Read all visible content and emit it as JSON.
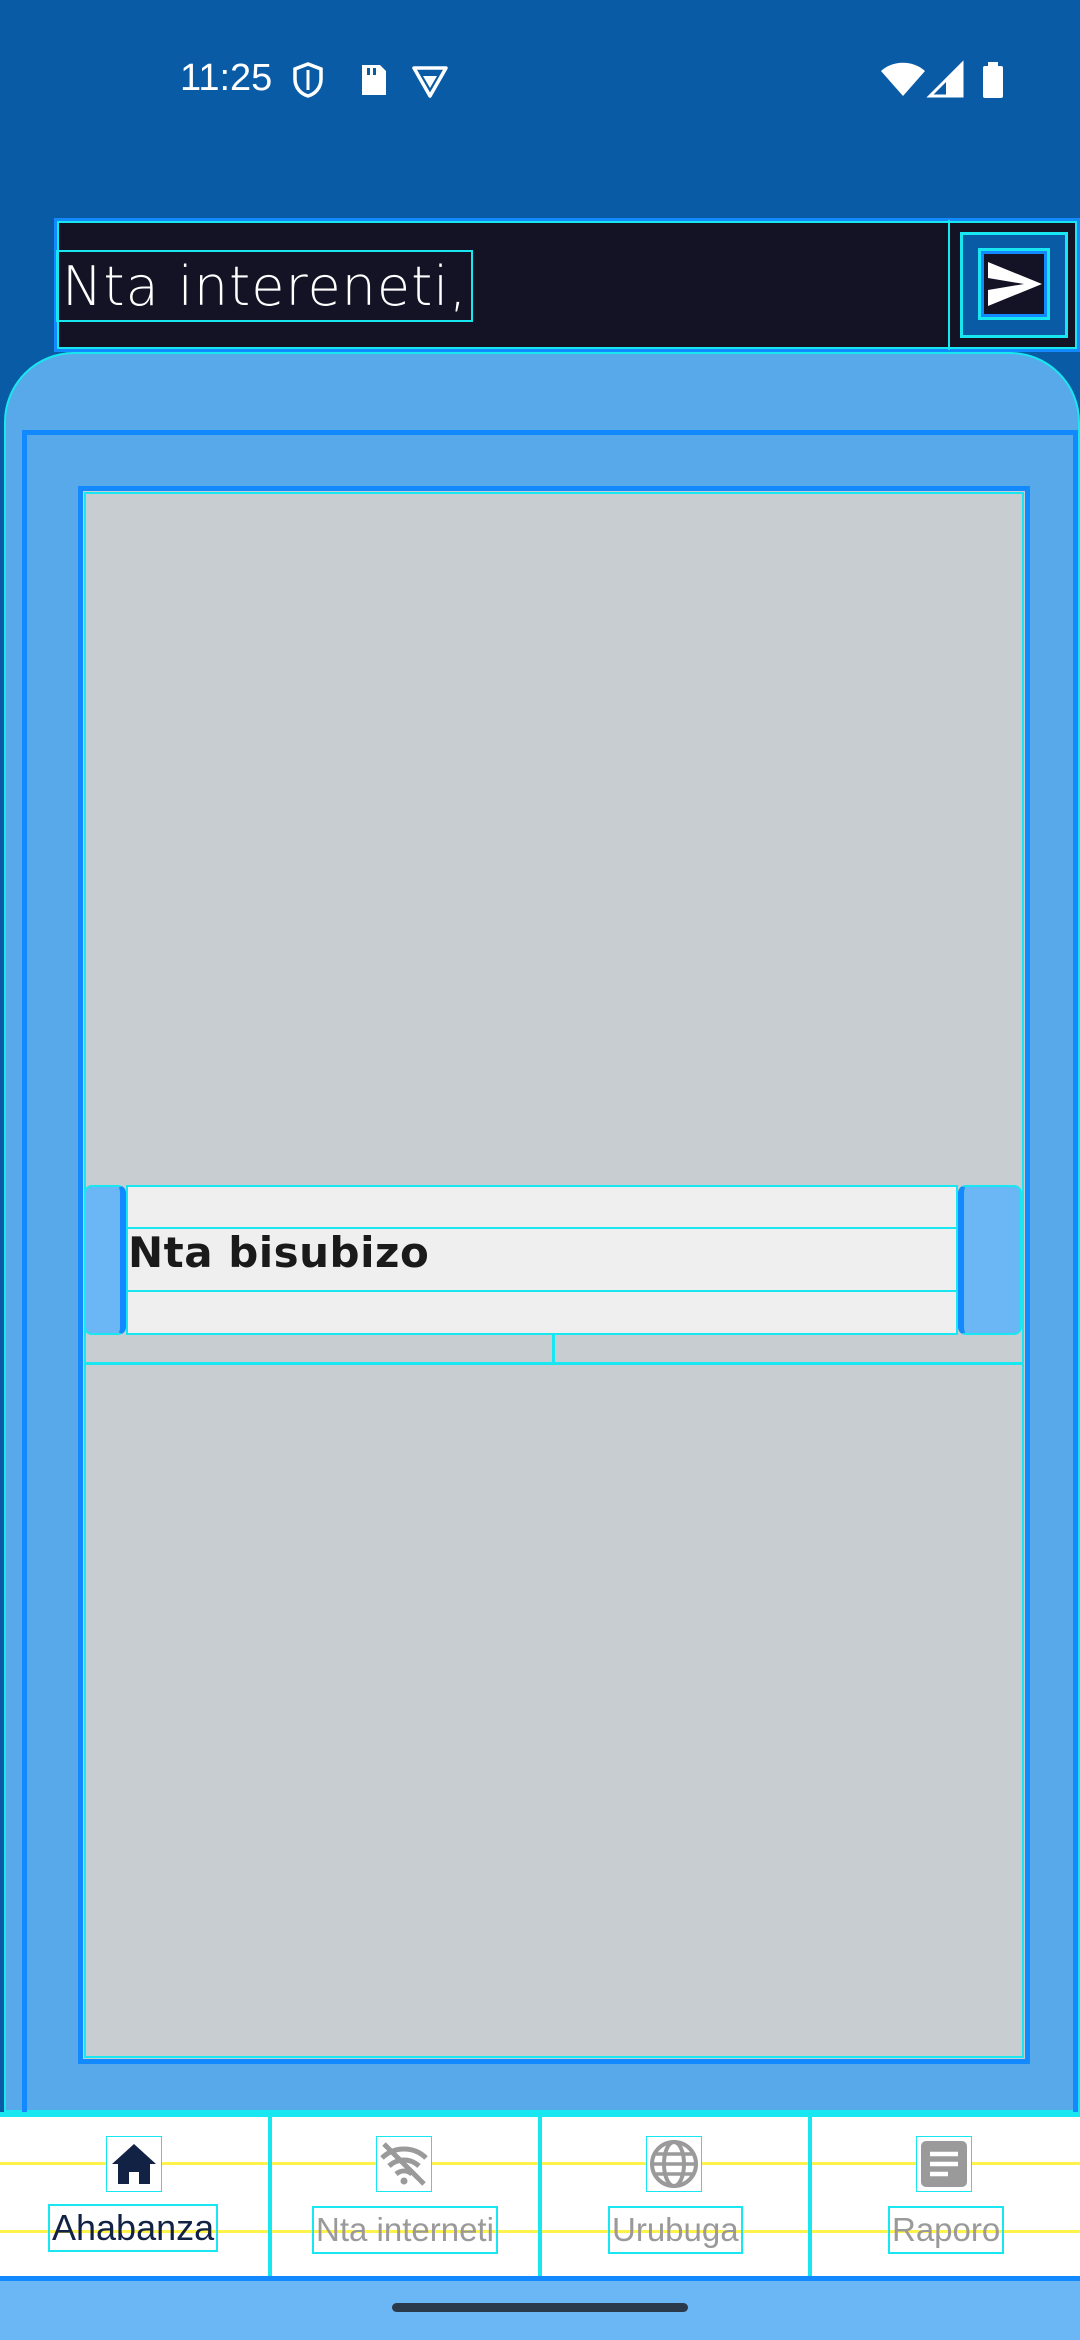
{
  "status_bar": {
    "time": "11:25",
    "icons": [
      "shield-icon",
      "sd-card-icon",
      "vpn-icon",
      "wifi-icon",
      "signal-icon",
      "battery-icon"
    ]
  },
  "header": {
    "title": "Nta intereneti,",
    "send_icon": "send-icon"
  },
  "main": {
    "message_text": "Nta bisubizo"
  },
  "bottom_nav": {
    "items": [
      {
        "label": "Ahabanza",
        "icon": "home-icon",
        "active": true
      },
      {
        "label": "Nta interneti",
        "icon": "wifi-off-icon",
        "active": false
      },
      {
        "label": "Urubuga",
        "icon": "globe-icon",
        "active": false
      },
      {
        "label": "Raporo",
        "icon": "report-icon",
        "active": false
      }
    ]
  },
  "colors": {
    "status_bar": "#0A5BA5",
    "header": "#141225",
    "card": "#58A9EA",
    "content": "#C8CDD1",
    "bubble": "#EFEFEF",
    "accent": "#1389FF",
    "nav_bg": "#FFFFFF",
    "active_icon": "#112244",
    "inactive_icon": "#9A9A9A"
  }
}
